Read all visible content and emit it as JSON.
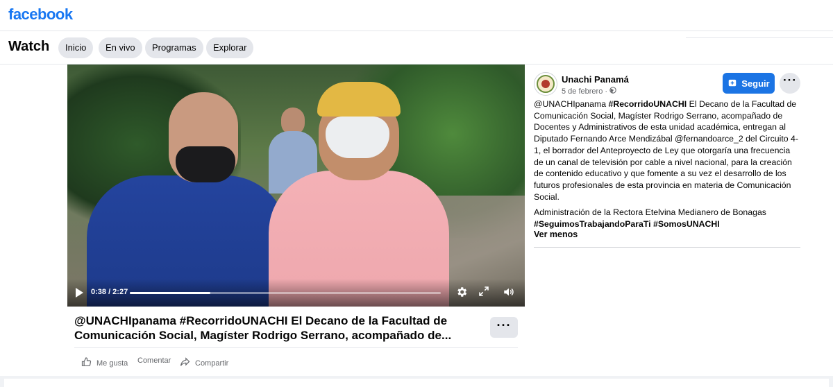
{
  "brand": {
    "logo": "facebook",
    "color": "#1877f2"
  },
  "watch": {
    "title": "Watch",
    "tabs": [
      {
        "label": "Inicio"
      },
      {
        "label": "En vivo"
      },
      {
        "label": "Programas"
      },
      {
        "label": "Explorar"
      }
    ]
  },
  "player": {
    "time": "0:38 / 2:27",
    "progress": 0.26
  },
  "post": {
    "title": "@UNACHIpanama #RecorridoUNACHI El Decano de la Facultad de Comunicación Social, Magíster Rodrigo Serrano, acompañado de...",
    "actions": {
      "like": "Me gusta",
      "comment": "Comentar",
      "share": "Compartir"
    }
  },
  "sidebar": {
    "page_name": "Unachi Panamá",
    "date": "5 de febrero ·",
    "follow_label": "Seguir",
    "description": {
      "mention": "@UNACHIpanama",
      "hashtag": "#RecorridoUNACHI",
      "text": " El Decano de la Facultad de Comunicación Social, Magíster Rodrigo Serrano, acompañado de Docentes y Administrativos de esta unidad académica, entregan al Diputado Fernando Arce Mendizábal @fernandoarce_2 del Circuito 4-1, el borrador del Anteproyecto de Ley que otorgaría una frecuencia de un canal de televisión por cable a nivel nacional, para la creación de contenido educativo y que fomente a su vez el desarrollo de los futuros profesionales de esta provincia en materia de Comunicación Social."
    },
    "admin_line": "Administración de la Rectora Etelvina Medianero de Bonagas",
    "hashtags": "#SeguimosTrabajandoParaTi #SomosUNACHI",
    "see_less": "Ver menos"
  }
}
